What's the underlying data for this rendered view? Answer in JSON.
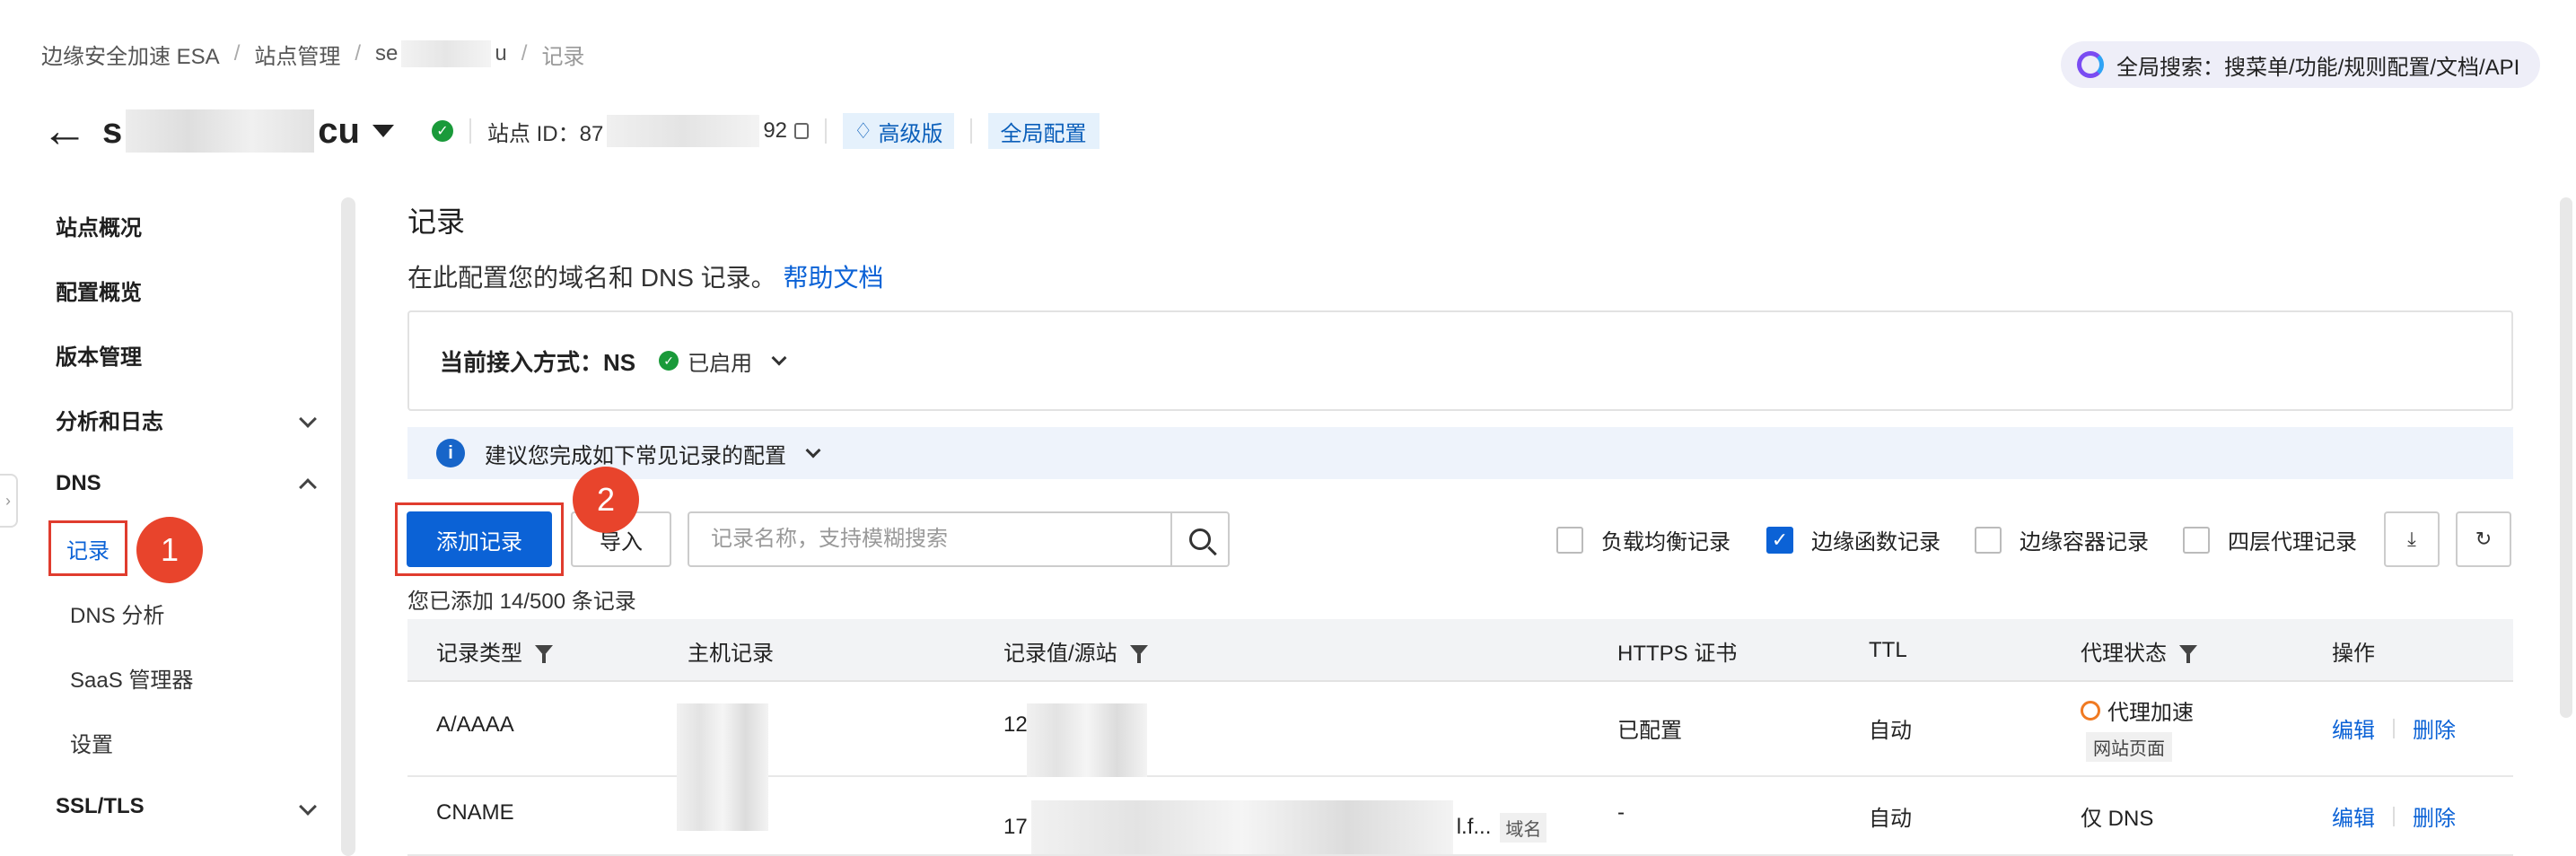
{
  "breadcrumb": {
    "items": [
      "边缘安全加速 ESA",
      "站点管理",
      "se",
      "u",
      "记录"
    ],
    "sep": "/"
  },
  "global_search": {
    "label": "全局搜索：搜菜单/功能/规则配置/文档/API"
  },
  "site": {
    "name_prefix": "s",
    "name_suffix": "cu",
    "id_label": "站点 ID：87",
    "id_suffix": "92",
    "plan_tag": "高级版",
    "global_config": "全局配置"
  },
  "sidebar": {
    "items": [
      {
        "label": "站点概况"
      },
      {
        "label": "配置概览"
      },
      {
        "label": "版本管理"
      },
      {
        "label": "分析和日志"
      },
      {
        "label": "DNS"
      },
      {
        "label": "SSL/TLS"
      }
    ],
    "dns_children": [
      {
        "label": "记录"
      },
      {
        "label": "DNS 分析"
      },
      {
        "label": "SaaS 管理器"
      },
      {
        "label": "设置"
      }
    ]
  },
  "annotations": {
    "badge1": "1",
    "badge2": "2"
  },
  "main": {
    "title": "记录",
    "desc": "在此配置您的域名和 DNS 记录。",
    "help_link": "帮助文档",
    "access_label": "当前接入方式：NS",
    "access_status": "已启用",
    "tip": "建议您完成如下常见记录的配置",
    "toolbar": {
      "add": "添加记录",
      "import": "导入",
      "search_placeholder": "记录名称，支持模糊搜索",
      "filters": [
        {
          "label": "负载均衡记录",
          "checked": false
        },
        {
          "label": "边缘函数记录",
          "checked": true
        },
        {
          "label": "边缘容器记录",
          "checked": false
        },
        {
          "label": "四层代理记录",
          "checked": false
        }
      ]
    },
    "count": "您已添加 14/500 条记录",
    "table": {
      "headers": [
        "记录类型",
        "主机记录",
        "记录值/源站",
        "HTTPS 证书",
        "TTL",
        "代理状态",
        "操作"
      ],
      "rows": [
        {
          "type": "A/AAAA",
          "value_prefix": "12",
          "https": "已配置",
          "ttl": "自动",
          "proxy": "代理加速",
          "proxy_sub": "网站页面",
          "edit": "编辑",
          "delete": "删除"
        },
        {
          "type": "CNAME",
          "value_prefix": "17",
          "value_suffix": "l.f...",
          "value_tag": "域名",
          "https": "-",
          "ttl": "自动",
          "proxy": "仅 DNS",
          "edit": "编辑",
          "delete": "删除"
        }
      ]
    }
  },
  "colors": {
    "primary": "#0b62d6",
    "annotation": "#e03c2e",
    "success": "#1a9a3a"
  }
}
